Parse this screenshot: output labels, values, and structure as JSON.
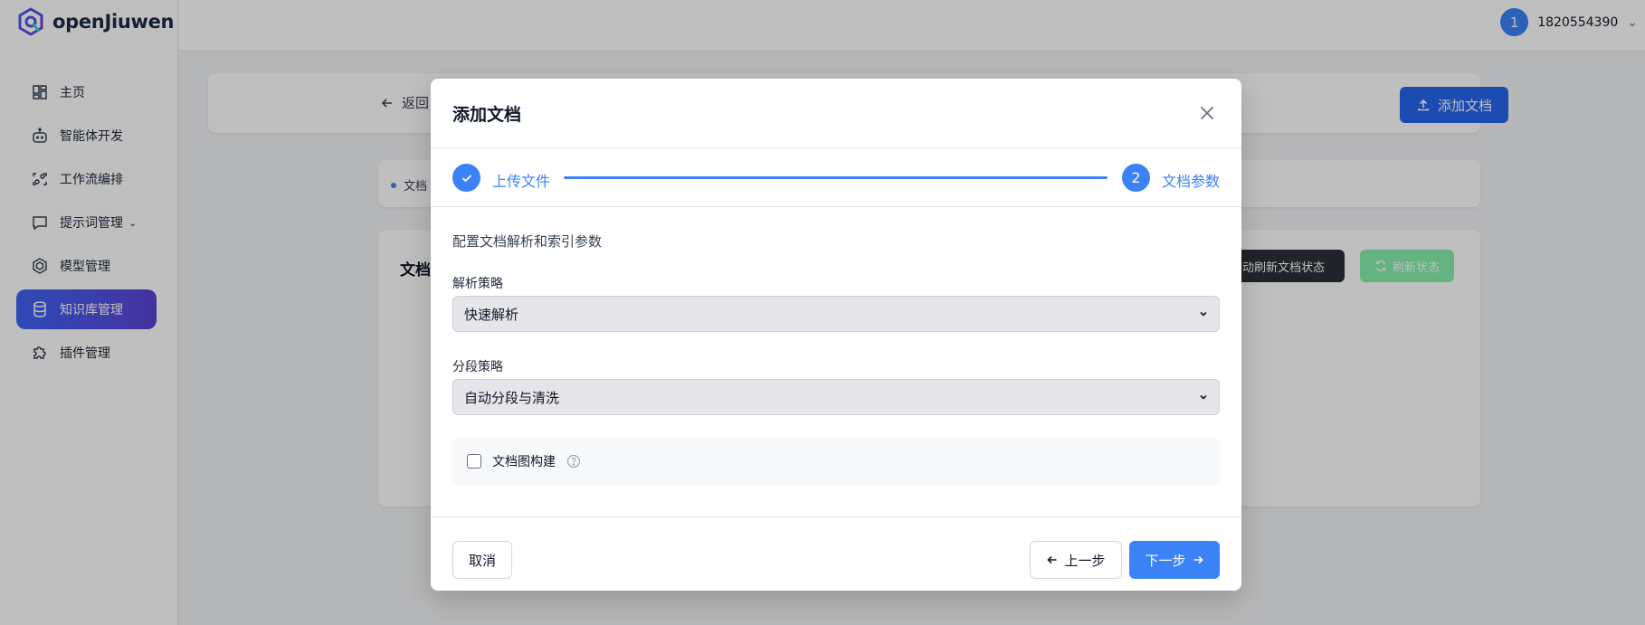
{
  "app": {
    "logo_text": "openJiuwen",
    "brand_color": "#3b5bdb"
  },
  "sidebar": {
    "items": [
      {
        "label": "主页",
        "icon": "dashboard-icon"
      },
      {
        "label": "智能体开发",
        "icon": "robot-icon"
      },
      {
        "label": "工作流编排",
        "icon": "workflow-icon"
      },
      {
        "label": "提示词管理",
        "icon": "message-icon",
        "caret": "⌄"
      },
      {
        "label": "模型管理",
        "icon": "model-icon"
      },
      {
        "label": "知识库管理",
        "icon": "database-icon",
        "active": true
      },
      {
        "label": "插件管理",
        "icon": "puzzle-icon"
      }
    ]
  },
  "topbar": {
    "avatar_text": "1",
    "username": "1820554390",
    "caret": "⌄"
  },
  "page": {
    "back_label": "返回",
    "add_document_label": "添加文档",
    "filter_tag": "文档",
    "list_title": "文档",
    "auto_refresh_label": "自动刷新文档状态",
    "refresh_label": "刷新状态"
  },
  "modal": {
    "title": "添加文档",
    "steps": [
      {
        "label": "上传文件",
        "status": "done"
      },
      {
        "number": "2",
        "label": "文档参数",
        "status": "current"
      }
    ],
    "subtitle": "配置文档解析和索引参数",
    "parse_strategy": {
      "label": "解析策略",
      "value": "快速解析"
    },
    "segment_strategy": {
      "label": "分段策略",
      "value": "自动分段与清洗"
    },
    "graph_build": {
      "label": "文档图构建",
      "checked": false
    },
    "footer": {
      "cancel_label": "取消",
      "prev_label": "上一步",
      "next_label": "下一步"
    }
  },
  "colors": {
    "primary": "#3b82f6",
    "nav_active_start": "#3e63f2",
    "nav_active_end": "#5b44d6",
    "refresh_green": "#86efac"
  }
}
